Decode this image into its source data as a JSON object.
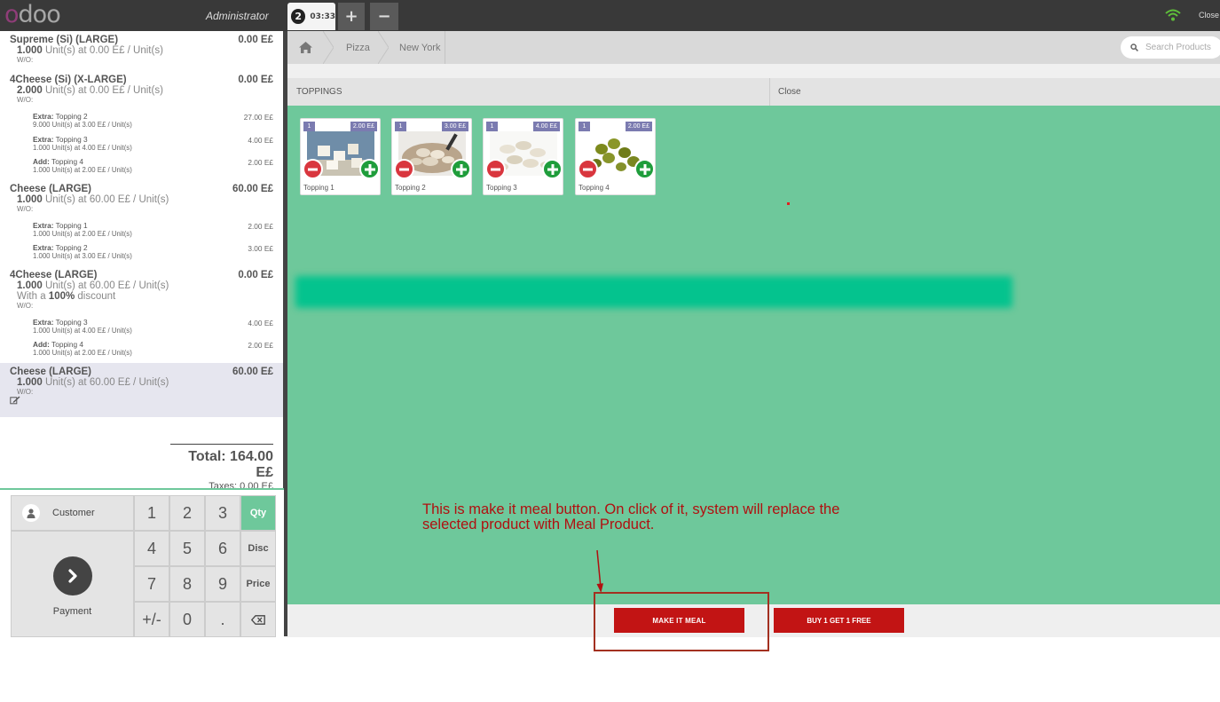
{
  "topbar": {
    "logo": "odoo",
    "user": "Administrator",
    "order_number": "2",
    "order_time": "03:33",
    "add_order": "+",
    "remove_order": "−",
    "close": "Close"
  },
  "order_lines": [
    {
      "name": "Supreme (Si) (LARGE)",
      "qty": "1.000",
      "info": " Unit(s) at 0.00 E£ / Unit(s)",
      "price": "0.00 E£",
      "note": "W/O:",
      "subs": []
    },
    {
      "name": "4Cheese (Si) (X-LARGE)",
      "qty": "2.000",
      "info": " Unit(s) at 0.00 E£ / Unit(s)",
      "price": "0.00 E£",
      "note": "W/O:",
      "subs": [
        {
          "type": "Extra:",
          "name": " Topping 2",
          "info": "9.000 Unit(s) at 3.00 E£ / Unit(s)",
          "price": "27.00 E£"
        },
        {
          "type": "Extra:",
          "name": " Topping 3",
          "info": "1.000 Unit(s) at 4.00 E£ / Unit(s)",
          "price": "4.00 E£"
        },
        {
          "type": "Add:",
          "name": " Topping 4",
          "info": "1.000 Unit(s) at 2.00 E£ / Unit(s)",
          "price": "2.00 E£"
        }
      ]
    },
    {
      "name": "Cheese (LARGE)",
      "qty": "1.000",
      "info": " Unit(s) at 60.00 E£ / Unit(s)",
      "price": "60.00 E£",
      "note": "W/O:",
      "subs": [
        {
          "type": "Extra:",
          "name": " Topping 1",
          "info": "1.000 Unit(s) at 2.00 E£ / Unit(s)",
          "price": "2.00 E£"
        },
        {
          "type": "Extra:",
          "name": " Topping 2",
          "info": "1.000 Unit(s) at 3.00 E£ / Unit(s)",
          "price": "3.00 E£"
        }
      ]
    },
    {
      "name": "4Cheese (LARGE)",
      "qty": "1.000",
      "info": " Unit(s) at 60.00 E£ / Unit(s)",
      "price": "0.00 E£",
      "discount_pre": "With a ",
      "discount": "100%",
      "discount_post": " discount",
      "note": "W/O:",
      "subs": [
        {
          "type": "Extra:",
          "name": " Topping 3",
          "info": "1.000 Unit(s) at 4.00 E£ / Unit(s)",
          "price": "4.00 E£"
        },
        {
          "type": "Add:",
          "name": " Topping 4",
          "info": "1.000 Unit(s) at 2.00 E£ / Unit(s)",
          "price": "2.00 E£"
        }
      ]
    },
    {
      "name": "Cheese (LARGE)",
      "qty": "1.000",
      "info": " Unit(s) at 60.00 E£ / Unit(s)",
      "price": "60.00 E£",
      "note": "W/O:",
      "subs": [],
      "selected": true
    }
  ],
  "totals": {
    "total": "Total: 164.00 E£",
    "taxes": "Taxes: 0.00 E£"
  },
  "numpad": {
    "customer": "Customer",
    "payment": "Payment",
    "keys": [
      "1",
      "2",
      "3",
      "Qty",
      "4",
      "5",
      "6",
      "Disc",
      "7",
      "8",
      "9",
      "Price",
      "+/-",
      "0",
      "."
    ],
    "active_mode": "Qty"
  },
  "breadcrumb": {
    "items": [
      "Pizza",
      "New York"
    ]
  },
  "search": {
    "placeholder": "Search Products"
  },
  "categories": {
    "left": "TOPPINGS",
    "right": "Close"
  },
  "products": [
    {
      "name": "Topping 1",
      "qty": "1",
      "price": "2.00 E£"
    },
    {
      "name": "Topping 2",
      "qty": "1",
      "price": "3.00 E£"
    },
    {
      "name": "Topping 3",
      "qty": "1",
      "price": "4.00 E£"
    },
    {
      "name": "Topping 4",
      "qty": "1",
      "price": "2.00 E£"
    }
  ],
  "annotation": "This is make it meal button. On click of it, system will replace the selected product with Meal Product.",
  "actions": {
    "make_meal": "MAKE IT MEAL",
    "bogo": "BUY 1 GET 1 FREE"
  },
  "colors": {
    "accent": "#6ec89b",
    "action_red": "#c21414",
    "topbar": "#393939",
    "brand": "#8f3d78"
  }
}
